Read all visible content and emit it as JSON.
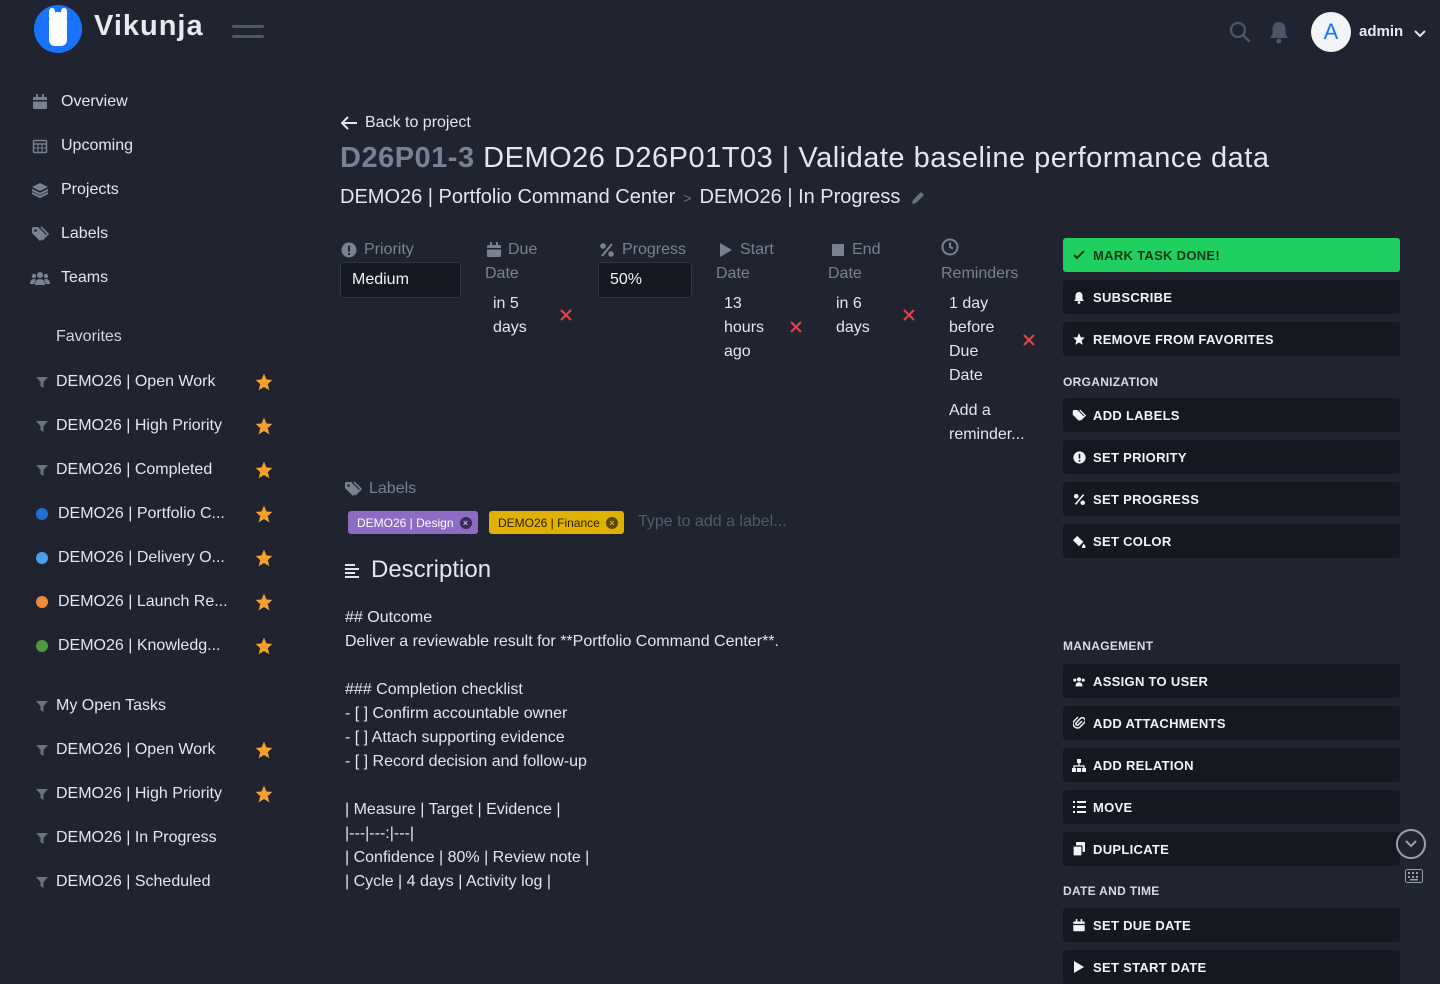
{
  "app": {
    "brand": "Vikunja"
  },
  "user": {
    "avatar_letter": "A",
    "name": "admin"
  },
  "nav": [
    {
      "label": "Overview",
      "icon": "calendar-icon"
    },
    {
      "label": "Upcoming",
      "icon": "calendar-grid-icon"
    },
    {
      "label": "Projects",
      "icon": "layers-icon"
    },
    {
      "label": "Labels",
      "icon": "tags-icon"
    },
    {
      "label": "Teams",
      "icon": "users-icon"
    }
  ],
  "favorites": {
    "heading": "Favorites",
    "items": [
      {
        "label": "DEMO26 | Open Work",
        "kind": "filter"
      },
      {
        "label": "DEMO26 | High Priority",
        "kind": "filter"
      },
      {
        "label": "DEMO26 | Completed",
        "kind": "filter"
      },
      {
        "label": "DEMO26 | Portfolio C...",
        "kind": "dot",
        "color": "#1f6fd1"
      },
      {
        "label": "DEMO26 | Delivery O...",
        "kind": "dot",
        "color": "#4a9eea"
      },
      {
        "label": "DEMO26 | Launch Re...",
        "kind": "dot",
        "color": "#f08a3a"
      },
      {
        "label": "DEMO26 | Knowledg...",
        "kind": "dot",
        "color": "#4f9a3a"
      }
    ]
  },
  "filters": {
    "items": [
      {
        "label": "My Open Tasks",
        "starred": false
      },
      {
        "label": "DEMO26 | Open Work",
        "starred": true
      },
      {
        "label": "DEMO26 | High Priority",
        "starred": true
      },
      {
        "label": "DEMO26 | In Progress",
        "starred": false
      },
      {
        "label": "DEMO26 | Scheduled",
        "starred": false
      }
    ]
  },
  "task": {
    "back_label": "Back to project",
    "identifier": "D26P01-3",
    "title": "DEMO26 D26P01T03 | Validate baseline performance data",
    "project": "DEMO26 | Portfolio Command Center",
    "crumb_sep": ">",
    "bucket": "DEMO26 | In Progress",
    "attributes": {
      "priority": {
        "label": "Priority",
        "value": "Medium"
      },
      "due": {
        "label_1": "Due",
        "label_2": "Date",
        "value_1": "in 5",
        "value_2": "days"
      },
      "progress": {
        "label": "Progress",
        "value": "50%"
      },
      "start": {
        "label_1": "Start",
        "label_2": "Date",
        "value_1": "13",
        "value_2": "hours",
        "value_3": "ago"
      },
      "end": {
        "label_1": "End",
        "label_2": "Date",
        "value_1": "in 6",
        "value_2": "days"
      },
      "reminders": {
        "label": "Reminders",
        "value_1": "1 day",
        "value_2": "before",
        "value_3": "Due",
        "value_4": "Date",
        "add_1": "Add a",
        "add_2": "reminder..."
      }
    },
    "labels_heading": "Labels",
    "labels": [
      {
        "text": "DEMO26 | Design",
        "bg": "#8e6bc4",
        "fg": "#ffffff"
      },
      {
        "text": "DEMO26 | Finance",
        "bg": "#e0b100",
        "fg": "#2a2300"
      }
    ],
    "label_placeholder": "Type to add a label...",
    "description_heading": "Description",
    "description": "## Outcome\nDeliver a reviewable result for **Portfolio Command Center**.\n\n### Completion checklist\n- [ ] Confirm accountable owner\n- [ ] Attach supporting evidence\n- [ ] Record decision and follow-up\n\n| Measure | Target | Evidence |\n|---|---:|---|\n| Confidence | 80% | Review note |\n| Cycle | 4 days | Activity log |"
  },
  "actions": {
    "mark_done": "MARK TASK DONE!",
    "subscribe": "SUBSCRIBE",
    "remove_fav": "REMOVE FROM FAVORITES",
    "org_heading": "ORGANIZATION",
    "add_labels": "ADD LABELS",
    "set_priority": "SET PRIORITY",
    "set_progress": "SET PROGRESS",
    "set_color": "SET COLOR",
    "mgmt_heading": "MANAGEMENT",
    "assign": "ASSIGN TO USER",
    "attachments": "ADD ATTACHMENTS",
    "relation": "ADD RELATION",
    "move": "MOVE",
    "duplicate": "DUPLICATE",
    "date_heading": "DATE AND TIME",
    "set_due": "SET DUE DATE",
    "set_start": "SET START DATE"
  },
  "colors": {
    "bg": "#1f2430",
    "panel": "#141821",
    "accent": "#1973ff",
    "done": "#1fd060",
    "danger": "#e8434a",
    "star": "#f8a02c"
  }
}
